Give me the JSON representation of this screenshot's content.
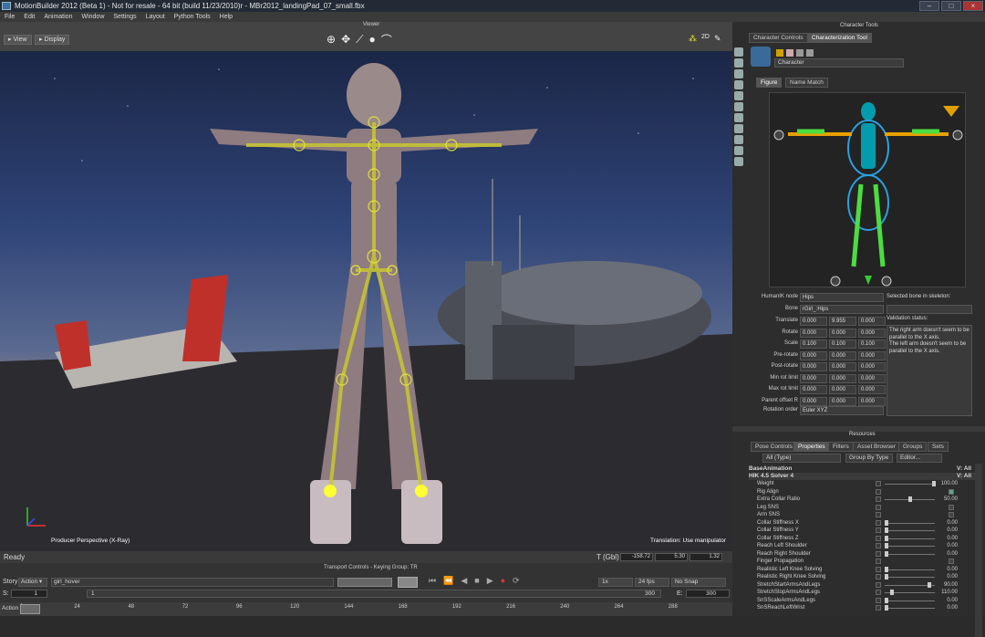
{
  "window": {
    "title": "MotionBuilder 2012 (Beta 1) - Not for resale  - 64 bit (build 11/23/2010)r - MBr2012_landingPad_07_small.fbx"
  },
  "menu": [
    "File",
    "Edit",
    "Animation",
    "Window",
    "Settings",
    "Layout",
    "Python Tools",
    "Help"
  ],
  "viewer": {
    "title": "Viewer",
    "view_button": "View",
    "display_button": "Display",
    "camera_label": "Producer Perspective (X-Ray)",
    "hint": "Translation: Use manipulator",
    "status": "Ready",
    "coord_label": "T (Gbl)",
    "coords": [
      "-158.72",
      "5.30",
      "1.32"
    ],
    "toggle_2d": "2D"
  },
  "character_tools": {
    "title": "Character Tools",
    "tabs": [
      "Character Controls",
      "Characterization Tool"
    ],
    "active_tab": 1,
    "character_dropdown": "Character",
    "subtabs": [
      "Figure",
      "Name Match"
    ],
    "humanik_node_label": "HumanIK node",
    "humanik_node_value": "Hips",
    "bone_label": "Bone",
    "bone_value": "rGirl_:Hips",
    "selected_bone_label": "Selected bone in skeleton:",
    "rows": [
      {
        "label": "Translate",
        "values": [
          "0.000",
          "9.955",
          "0.000"
        ]
      },
      {
        "label": "Rotate",
        "values": [
          "0.000",
          "0.000",
          "0.000"
        ]
      },
      {
        "label": "Scale",
        "values": [
          "0.100",
          "0.100",
          "0.100"
        ]
      },
      {
        "label": "Pre-rotate",
        "values": [
          "0.000",
          "0.000",
          "0.000"
        ]
      },
      {
        "label": "Post-rotate",
        "values": [
          "0.000",
          "0.000",
          "0.000"
        ]
      },
      {
        "label": "Min rot limit",
        "values": [
          "0.000",
          "0.000",
          "0.000"
        ]
      },
      {
        "label": "Max rot limit",
        "values": [
          "0.000",
          "0.000",
          "0.000"
        ]
      },
      {
        "label": "Parent offset R",
        "values": [
          "0.000",
          "0.000",
          "0.000"
        ]
      }
    ],
    "rotation_order_label": "Rotation order",
    "rotation_order_value": "Euler XYZ",
    "validation_label": "Validation status:",
    "validation_text": "The right arm doesn't seem to be parallel to the X axis.\nThe left arm doesn't seem to be parallel to the X axis."
  },
  "resources": {
    "title": "Resources",
    "tabs": [
      "Pose Controls",
      "Properties",
      "Filters",
      "Asset Browser",
      "Groups",
      "Sets"
    ],
    "active_tab": 1,
    "filter": "All (Type)",
    "group_by": "Group By Type",
    "editor": "Editor...",
    "sections": [
      {
        "label": "BaseAnimation",
        "value": "V: All"
      },
      {
        "label": "HIK 4.5 Solver 4",
        "value": "V: All"
      }
    ],
    "props": [
      {
        "label": "Weight",
        "value": "100.00",
        "slider": 1.0
      },
      {
        "label": "Rig Align",
        "value": "",
        "check": true
      },
      {
        "label": "Extra Collar Ratio",
        "value": "50.00",
        "slider": 0.5
      },
      {
        "label": "Leg SNS",
        "value": ""
      },
      {
        "label": "Arm SNS",
        "value": ""
      },
      {
        "label": "Collar Stiffness X",
        "value": "0.00",
        "slider": 0.0
      },
      {
        "label": "Collar Stiffness Y",
        "value": "0.00",
        "slider": 0.0
      },
      {
        "label": "Collar Stiffness Z",
        "value": "0.00",
        "slider": 0.0
      },
      {
        "label": "Reach Left Shoulder",
        "value": "0.00",
        "slider": 0.0
      },
      {
        "label": "Reach Right Shoulder",
        "value": "0.00",
        "slider": 0.0
      },
      {
        "label": "Finger Propagation",
        "value": ""
      },
      {
        "label": "Realistic Left Knee Solving",
        "value": "0.00",
        "slider": 0.0
      },
      {
        "label": "Realistic Right Knee Solving",
        "value": "0.00",
        "slider": 0.0
      },
      {
        "label": "StretchStartArmsAndLegs",
        "value": "90.00",
        "slider": 0.9
      },
      {
        "label": "StretchStopArmsAndLegs",
        "value": "110.00",
        "slider": 0.11
      },
      {
        "label": "SnSScaleArmsAndLegs",
        "value": "0.00",
        "slider": 0.0
      },
      {
        "label": "SnSReachLeftWrist",
        "value": "0.00",
        "slider": 0.0
      }
    ]
  },
  "transport": {
    "title": "Transport Controls  -  Keying Group: TR",
    "story_label": "Story",
    "action_label": "Action",
    "take": "girl_hover",
    "speed": "1x",
    "fps": "24 fps",
    "snap": "No Snap",
    "start_label": "S:",
    "start": "1",
    "end_label": "E:",
    "end": "300",
    "current": "1",
    "range_end": "300",
    "ruler_label": "Action",
    "ticks": [
      "0",
      "24",
      "48",
      "72",
      "96",
      "120",
      "144",
      "168",
      "192",
      "216",
      "240",
      "264",
      "288"
    ]
  },
  "colors": {
    "accent": "#3d6fa8",
    "rig": "#c8c830",
    "active_tab": "#555555"
  }
}
